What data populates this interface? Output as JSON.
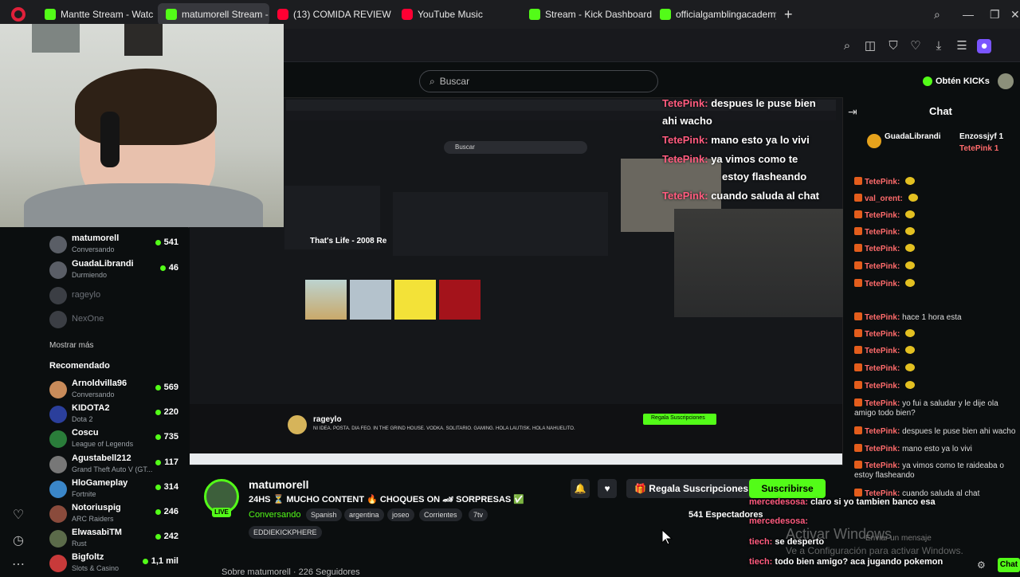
{
  "browser": {
    "tabs": [
      {
        "label": "Mantte Stream - Watc",
        "icon": "kick-icon"
      },
      {
        "label": "matumorell Stream - V",
        "icon": "kick-icon",
        "active": true
      },
      {
        "label": "(13) COMIDA REVIEW | M",
        "icon": "youtube-icon"
      },
      {
        "label": "YouTube Music",
        "icon": "youtube-music-icon"
      },
      {
        "label": "Stream - Kick Dashboard",
        "icon": "kick-icon"
      },
      {
        "label": "officialgamblingacademy",
        "icon": "kick-icon"
      }
    ]
  },
  "header": {
    "search_placeholder": "Buscar",
    "get_kicks": "Obtén KICKs"
  },
  "sidebar": {
    "following": [
      {
        "name": "matumorell",
        "category": "Conversando",
        "count": "541",
        "live": true
      },
      {
        "name": "GuadaLibrandi",
        "category": "Durmiendo",
        "count": "46",
        "live": true
      },
      {
        "name": "rageylo",
        "category": "",
        "count": "",
        "live": false
      },
      {
        "name": "NexOne",
        "category": "",
        "count": "",
        "live": false
      }
    ],
    "show_more": "Mostrar más",
    "recommended_title": "Recomendado",
    "recommended": [
      {
        "name": "Arnoldvilla96",
        "category": "Conversando",
        "count": "569"
      },
      {
        "name": "KIDOTA2",
        "category": "Dota 2",
        "count": "220"
      },
      {
        "name": "Coscu",
        "category": "League of Legends",
        "count": "735"
      },
      {
        "name": "Agustabell212",
        "category": "Grand Theft Auto V (GT...",
        "count": "117"
      },
      {
        "name": "HloGameplay",
        "category": "Fortnite",
        "count": "314"
      },
      {
        "name": "Notoriuspig",
        "category": "ARC Raiders",
        "count": "246"
      },
      {
        "name": "ElwasabiTM",
        "category": "Rust",
        "count": "242"
      },
      {
        "name": "Bigfoltz",
        "category": "Slots & Casino",
        "count": "1,1 mil"
      }
    ]
  },
  "stream": {
    "inner_search": "Buscar",
    "inner_song": "That's Life - 2008 Re",
    "inner_streamer": "rageylo",
    "inner_title": "NI IDEA. POSTA. DIA FEO. IN THE GRIND HOUSE. VODKA. SOLITARIO. GAMING. HOLA LAUTISK. HOLA NAHUELITO.",
    "inner_sub": "Regala Suscripciones",
    "overlay_messages": [
      {
        "user": "TetePink:",
        "text": "despues le puse bien"
      },
      {
        "user": "",
        "text": "ahi wacho"
      },
      {
        "user": "TetePink:",
        "text": "mano esto ya lo vivi"
      },
      {
        "user": "TetePink:",
        "text": "ya vimos como te"
      },
      {
        "user": "",
        "text": "estoy flasheando"
      },
      {
        "user": "TetePink:",
        "text": "cuando saluda al chat"
      }
    ]
  },
  "streamer": {
    "name": "matumorell",
    "live_label": "LIVE",
    "title": "24HS ⏳ MUCHO CONTENT 🔥 CHOQUES ON 🏎 SORPRESAS ✅",
    "category": "Conversando",
    "tags": [
      "Spanish",
      "argentina",
      "joseo",
      "Corrientes",
      "7tv"
    ],
    "extra_tag": "EDDIEKICKPHERE",
    "gift_label": "Regala Suscripciones",
    "subscribe_label": "Suscribirse",
    "viewers": "541 Espectadores",
    "about": "Sobre matumorell · 226 Seguidores"
  },
  "chat": {
    "title": "Chat",
    "top_users": [
      "GuadaLibrandi",
      "Enzossjyf 1",
      "TetePink 1"
    ],
    "messages": [
      {
        "user": "TetePink:",
        "text": ""
      },
      {
        "user": "val_orent:",
        "text": ""
      },
      {
        "user": "TetePink:",
        "text": ""
      },
      {
        "user": "TetePink:",
        "text": ""
      },
      {
        "user": "TetePink:",
        "text": ""
      },
      {
        "user": "TetePink:",
        "text": ""
      },
      {
        "user": "TetePink:",
        "text": ""
      },
      {
        "user": "TetePink:",
        "text": "hace 1 hora esta"
      },
      {
        "user": "TetePink:",
        "text": ""
      },
      {
        "user": "TetePink:",
        "text": ""
      },
      {
        "user": "TetePink:",
        "text": ""
      },
      {
        "user": "TetePink:",
        "text": ""
      },
      {
        "user": "TetePink:",
        "text": "yo fui a saludar y le dije ola amigo todo bien?"
      },
      {
        "user": "TetePink:",
        "text": "despues le puse bien ahi wacho"
      },
      {
        "user": "TetePink:",
        "text": "mano esto ya lo vivi"
      },
      {
        "user": "TetePink:",
        "text": "ya vimos como te raideaba o estoy flasheando"
      },
      {
        "user": "TetePink:",
        "text": "cuando saluda al chat"
      }
    ],
    "bottom_messages": [
      {
        "user": "mercedesosa:",
        "text": "claro si yo tambien banco esa"
      },
      {
        "user": "mercedesosa:",
        "text": ""
      },
      {
        "user": "tiech:",
        "text": "se desperto"
      },
      {
        "user": "tiech:",
        "text": "todo bien amigo? aca jugando pokemon"
      }
    ],
    "input_placeholder": "Enviar un mensaje",
    "send_label": "Chat",
    "watermark": "Activar Windows",
    "watermark_sub": "Ve a Configuración para activar Windows."
  }
}
